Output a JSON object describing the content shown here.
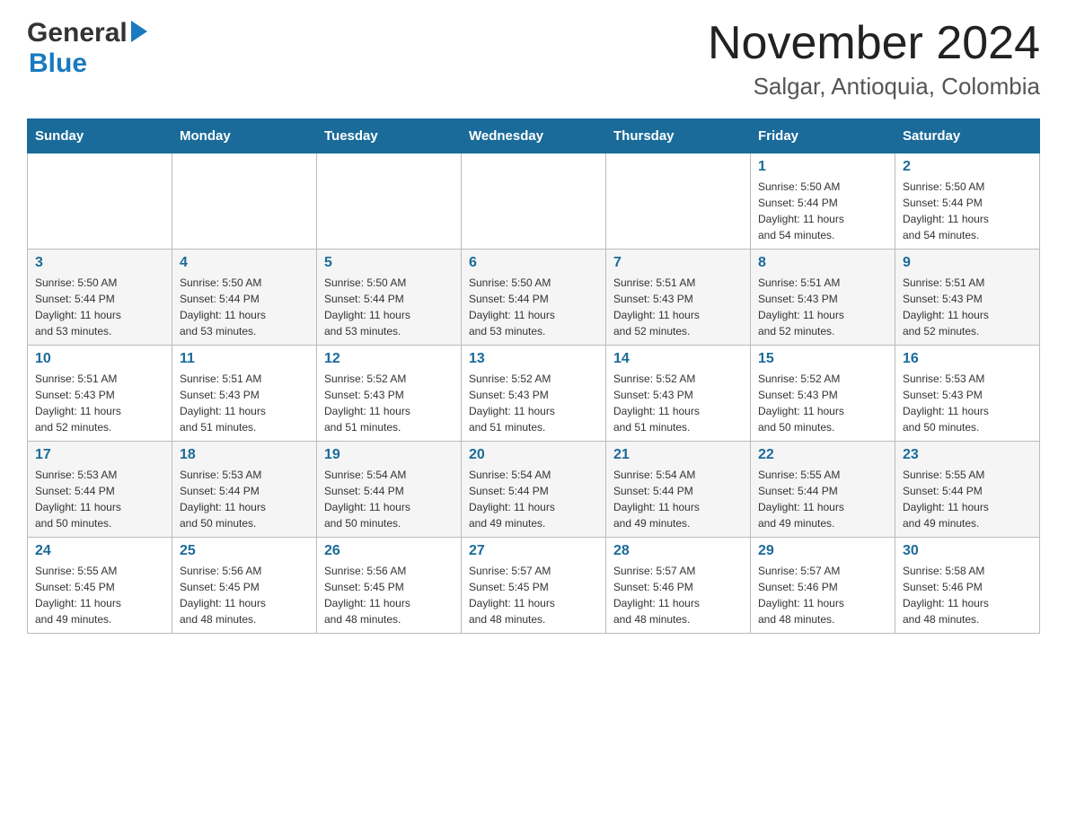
{
  "header": {
    "logo_general": "General",
    "logo_blue": "Blue",
    "month_title": "November 2024",
    "location": "Salgar, Antioquia, Colombia"
  },
  "calendar": {
    "days_of_week": [
      "Sunday",
      "Monday",
      "Tuesday",
      "Wednesday",
      "Thursday",
      "Friday",
      "Saturday"
    ],
    "weeks": [
      [
        {
          "day": "",
          "info": ""
        },
        {
          "day": "",
          "info": ""
        },
        {
          "day": "",
          "info": ""
        },
        {
          "day": "",
          "info": ""
        },
        {
          "day": "",
          "info": ""
        },
        {
          "day": "1",
          "info": "Sunrise: 5:50 AM\nSunset: 5:44 PM\nDaylight: 11 hours\nand 54 minutes."
        },
        {
          "day": "2",
          "info": "Sunrise: 5:50 AM\nSunset: 5:44 PM\nDaylight: 11 hours\nand 54 minutes."
        }
      ],
      [
        {
          "day": "3",
          "info": "Sunrise: 5:50 AM\nSunset: 5:44 PM\nDaylight: 11 hours\nand 53 minutes."
        },
        {
          "day": "4",
          "info": "Sunrise: 5:50 AM\nSunset: 5:44 PM\nDaylight: 11 hours\nand 53 minutes."
        },
        {
          "day": "5",
          "info": "Sunrise: 5:50 AM\nSunset: 5:44 PM\nDaylight: 11 hours\nand 53 minutes."
        },
        {
          "day": "6",
          "info": "Sunrise: 5:50 AM\nSunset: 5:44 PM\nDaylight: 11 hours\nand 53 minutes."
        },
        {
          "day": "7",
          "info": "Sunrise: 5:51 AM\nSunset: 5:43 PM\nDaylight: 11 hours\nand 52 minutes."
        },
        {
          "day": "8",
          "info": "Sunrise: 5:51 AM\nSunset: 5:43 PM\nDaylight: 11 hours\nand 52 minutes."
        },
        {
          "day": "9",
          "info": "Sunrise: 5:51 AM\nSunset: 5:43 PM\nDaylight: 11 hours\nand 52 minutes."
        }
      ],
      [
        {
          "day": "10",
          "info": "Sunrise: 5:51 AM\nSunset: 5:43 PM\nDaylight: 11 hours\nand 52 minutes."
        },
        {
          "day": "11",
          "info": "Sunrise: 5:51 AM\nSunset: 5:43 PM\nDaylight: 11 hours\nand 51 minutes."
        },
        {
          "day": "12",
          "info": "Sunrise: 5:52 AM\nSunset: 5:43 PM\nDaylight: 11 hours\nand 51 minutes."
        },
        {
          "day": "13",
          "info": "Sunrise: 5:52 AM\nSunset: 5:43 PM\nDaylight: 11 hours\nand 51 minutes."
        },
        {
          "day": "14",
          "info": "Sunrise: 5:52 AM\nSunset: 5:43 PM\nDaylight: 11 hours\nand 51 minutes."
        },
        {
          "day": "15",
          "info": "Sunrise: 5:52 AM\nSunset: 5:43 PM\nDaylight: 11 hours\nand 50 minutes."
        },
        {
          "day": "16",
          "info": "Sunrise: 5:53 AM\nSunset: 5:43 PM\nDaylight: 11 hours\nand 50 minutes."
        }
      ],
      [
        {
          "day": "17",
          "info": "Sunrise: 5:53 AM\nSunset: 5:44 PM\nDaylight: 11 hours\nand 50 minutes."
        },
        {
          "day": "18",
          "info": "Sunrise: 5:53 AM\nSunset: 5:44 PM\nDaylight: 11 hours\nand 50 minutes."
        },
        {
          "day": "19",
          "info": "Sunrise: 5:54 AM\nSunset: 5:44 PM\nDaylight: 11 hours\nand 50 minutes."
        },
        {
          "day": "20",
          "info": "Sunrise: 5:54 AM\nSunset: 5:44 PM\nDaylight: 11 hours\nand 49 minutes."
        },
        {
          "day": "21",
          "info": "Sunrise: 5:54 AM\nSunset: 5:44 PM\nDaylight: 11 hours\nand 49 minutes."
        },
        {
          "day": "22",
          "info": "Sunrise: 5:55 AM\nSunset: 5:44 PM\nDaylight: 11 hours\nand 49 minutes."
        },
        {
          "day": "23",
          "info": "Sunrise: 5:55 AM\nSunset: 5:44 PM\nDaylight: 11 hours\nand 49 minutes."
        }
      ],
      [
        {
          "day": "24",
          "info": "Sunrise: 5:55 AM\nSunset: 5:45 PM\nDaylight: 11 hours\nand 49 minutes."
        },
        {
          "day": "25",
          "info": "Sunrise: 5:56 AM\nSunset: 5:45 PM\nDaylight: 11 hours\nand 48 minutes."
        },
        {
          "day": "26",
          "info": "Sunrise: 5:56 AM\nSunset: 5:45 PM\nDaylight: 11 hours\nand 48 minutes."
        },
        {
          "day": "27",
          "info": "Sunrise: 5:57 AM\nSunset: 5:45 PM\nDaylight: 11 hours\nand 48 minutes."
        },
        {
          "day": "28",
          "info": "Sunrise: 5:57 AM\nSunset: 5:46 PM\nDaylight: 11 hours\nand 48 minutes."
        },
        {
          "day": "29",
          "info": "Sunrise: 5:57 AM\nSunset: 5:46 PM\nDaylight: 11 hours\nand 48 minutes."
        },
        {
          "day": "30",
          "info": "Sunrise: 5:58 AM\nSunset: 5:46 PM\nDaylight: 11 hours\nand 48 minutes."
        }
      ]
    ]
  }
}
